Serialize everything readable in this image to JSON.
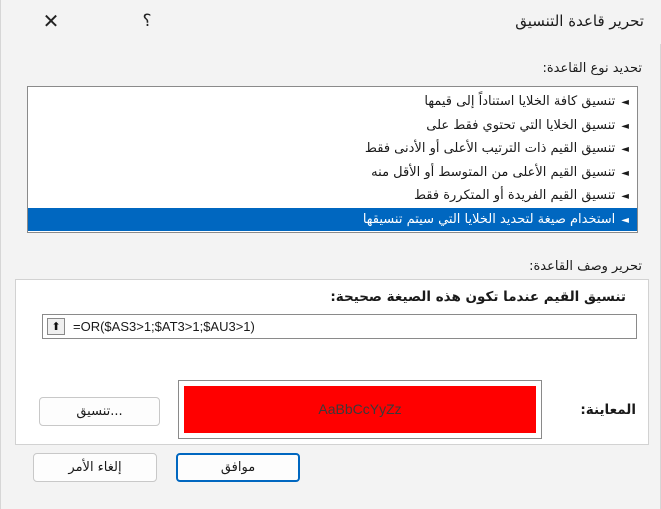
{
  "dialog": {
    "title": "تحرير قاعدة التنسيق",
    "close_glyph": "✕",
    "help_glyph": "؟"
  },
  "rule_type": {
    "label": "تحديد نوع القاعدة:",
    "items": [
      {
        "label": "تنسيق كافة الخلايا استناداً إلى قيمها",
        "selected": false
      },
      {
        "label": "تنسيق الخلايا التي تحتوي فقط على",
        "selected": false
      },
      {
        "label": "تنسيق القيم ذات الترتيب الأعلى أو الأدنى فقط",
        "selected": false
      },
      {
        "label": "تنسيق القيم الأعلى من المتوسط أو الأقل منه",
        "selected": false
      },
      {
        "label": "تنسيق القيم الفريدة أو المتكررة فقط",
        "selected": false
      },
      {
        "label": "استخدام صيغة لتحديد الخلايا التي سيتم تنسيقها",
        "selected": true
      }
    ],
    "arrow_glyph": "◄",
    "selected_color": "#0067c0"
  },
  "rule_description": {
    "label": "تحرير وصف القاعدة:",
    "formula_title": "تنسيق القيم عندما تكون هذه الصيغة صحيحة:",
    "formula_value": "=OR($AS3>1;$AT3>1;$AU3>1)",
    "collapse_icon": "upload-arrow-icon",
    "collapse_glyph": "⬆"
  },
  "preview": {
    "label": "المعاينة:",
    "sample_text": "AaBbCcYyZz",
    "fill_color": "#ff0000"
  },
  "buttons": {
    "format": "تنسيق...",
    "ok": "موافق",
    "cancel": "إلغاء الأمر"
  }
}
